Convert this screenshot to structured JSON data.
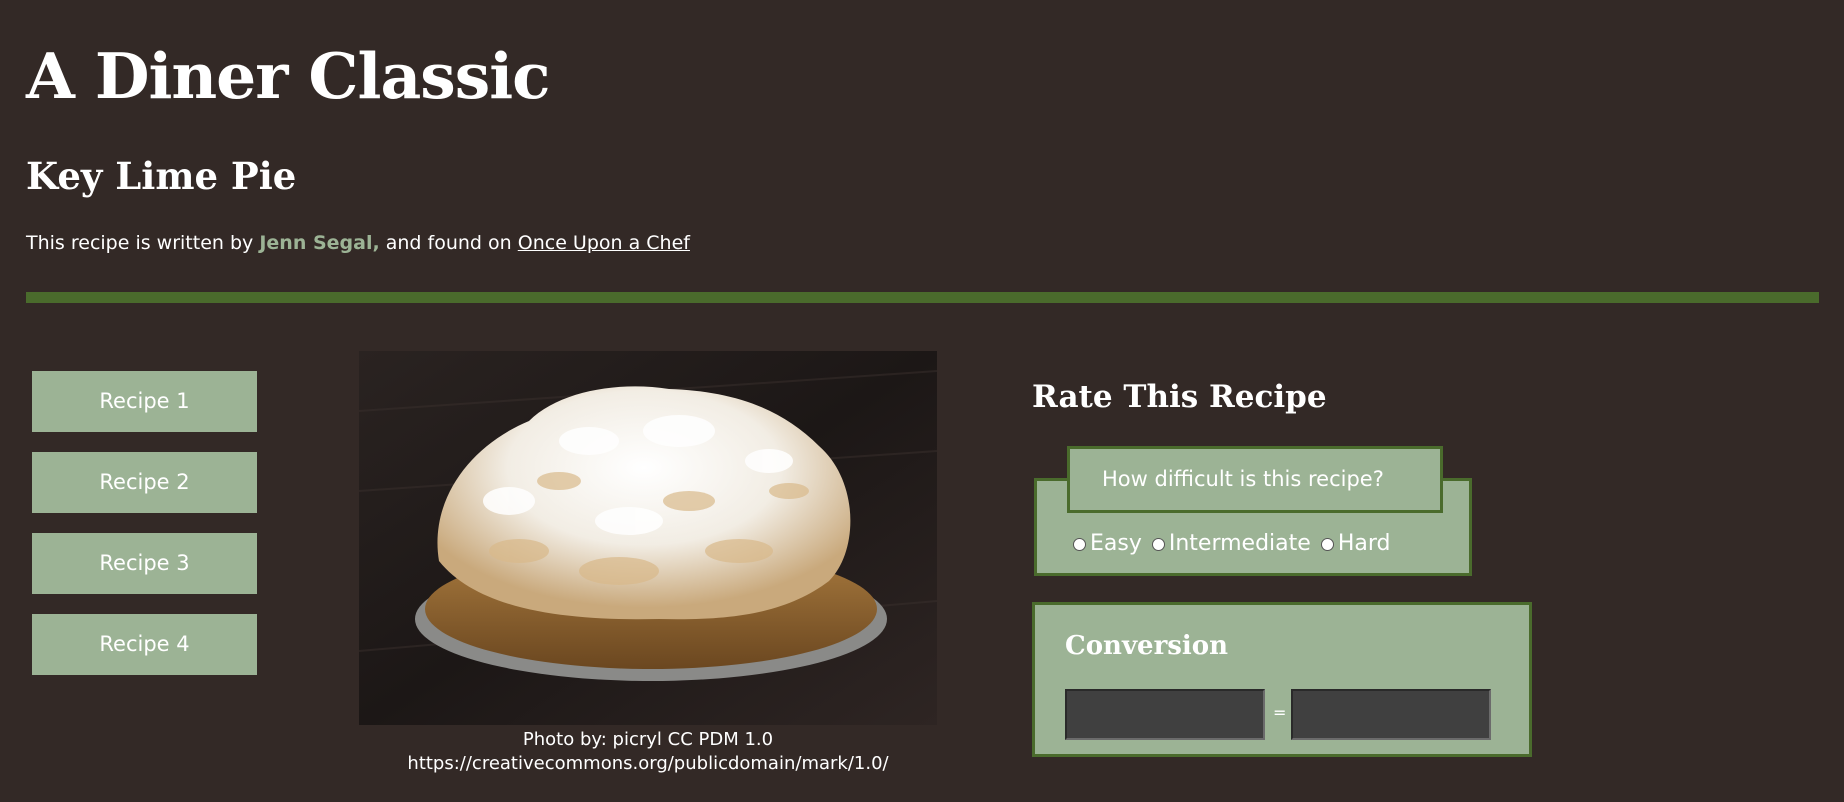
{
  "header": {
    "title": "A Diner Classic",
    "recipe_name": "Key Lime Pie",
    "byline_prefix": "This recipe is written by",
    "author": "Jenn Segal,",
    "byline_middle": "and found on",
    "source_link": "Once Upon a Chef"
  },
  "colors": {
    "background": "#332926",
    "accent_green": "#4a6b2c",
    "sage": "#9cb395",
    "input_dark": "#404040"
  },
  "nav": {
    "items": [
      {
        "label": "Recipe 1"
      },
      {
        "label": "Recipe 2"
      },
      {
        "label": "Recipe 3"
      },
      {
        "label": "Recipe 4"
      }
    ]
  },
  "photo": {
    "caption_line1": "Photo by: picryl CC PDM 1.0",
    "caption_line2": "https://creativecommons.org/publicdomain/mark/1.0/"
  },
  "rating": {
    "title": "Rate This Recipe",
    "question": "How difficult is this recipe?",
    "options": [
      {
        "label": "Easy"
      },
      {
        "label": "Intermediate"
      },
      {
        "label": "Hard"
      }
    ]
  },
  "conversion": {
    "title": "Conversion",
    "equals": "=",
    "left_value": "",
    "right_value": ""
  }
}
